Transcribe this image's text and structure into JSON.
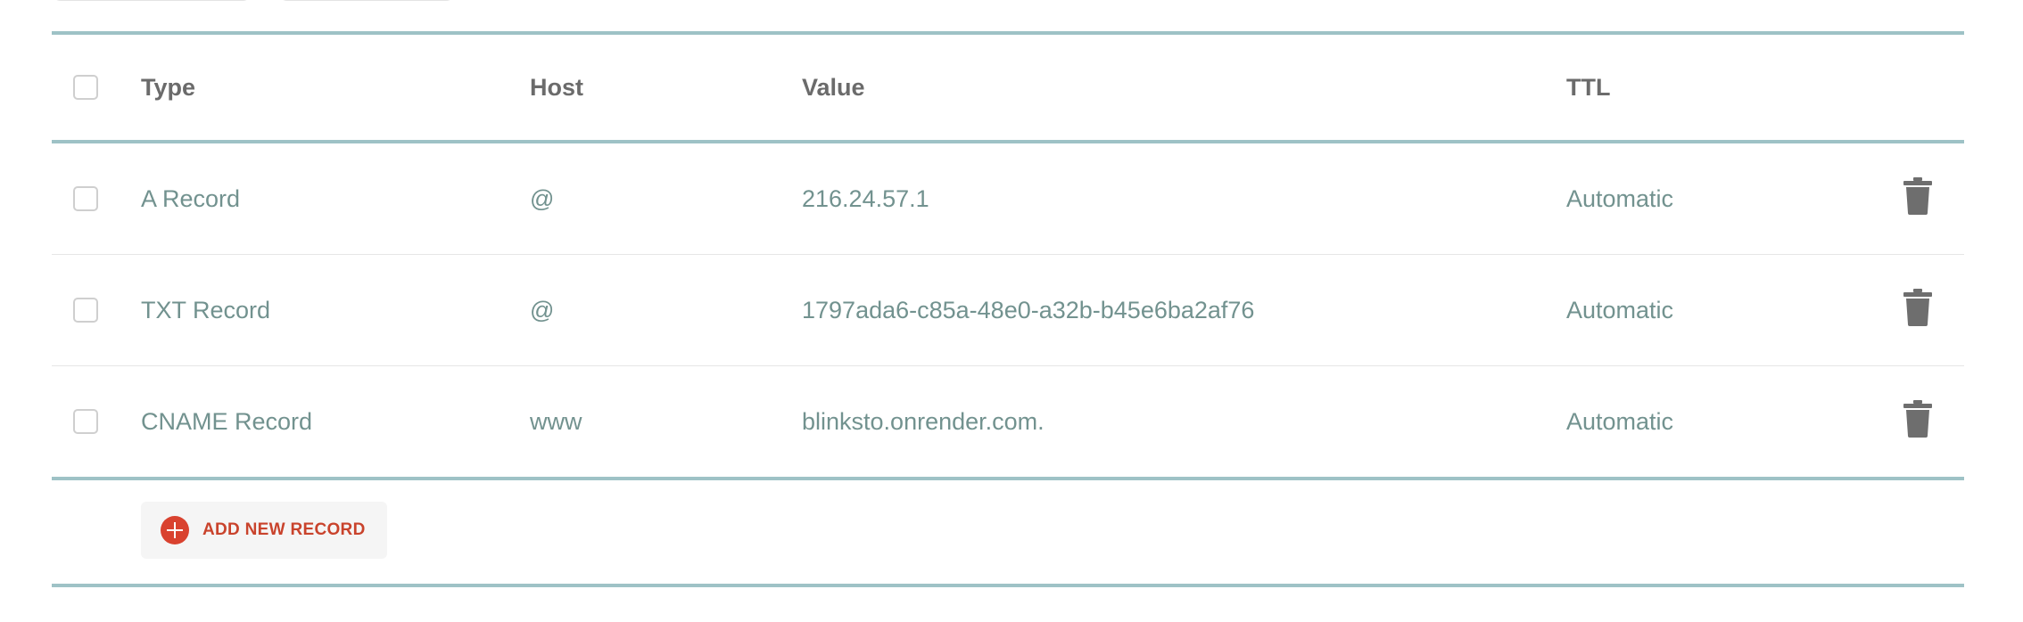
{
  "table": {
    "headers": {
      "type": "Type",
      "host": "Host",
      "value": "Value",
      "ttl": "TTL"
    },
    "rows": [
      {
        "type": "A Record",
        "host": "@",
        "value": "216.24.57.1",
        "ttl": "Automatic"
      },
      {
        "type": "TXT Record",
        "host": "@",
        "value": "1797ada6-c85a-48e0-a32b-b45e6ba2af76",
        "ttl": "Automatic"
      },
      {
        "type": "CNAME Record",
        "host": "www",
        "value": "blinksto.onrender.com.",
        "ttl": "Automatic"
      }
    ]
  },
  "footer": {
    "add_label": "ADD NEW RECORD"
  },
  "icons": {
    "delete": "trash-icon",
    "add": "plus-circle-icon"
  },
  "colors": {
    "rule": "#9ec2c6",
    "cell_text": "#72928f",
    "header_text": "#6b6b6b",
    "accent": "#d9422f",
    "trash": "#6e6e6e"
  }
}
